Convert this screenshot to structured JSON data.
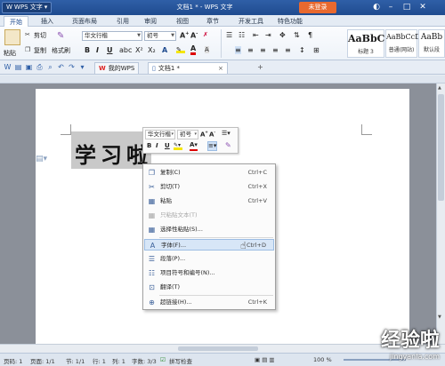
{
  "titlebar": {
    "app_name": "WPS 文字",
    "window_title": "文档1 * - WPS 文字",
    "login_label": "未登录"
  },
  "ribbon_tabs": [
    "开始",
    "插入",
    "页面布局",
    "引用",
    "审阅",
    "视图",
    "章节",
    "开发工具",
    "特色功能"
  ],
  "ribbon": {
    "paste_label": "粘贴",
    "cut_label": "剪切",
    "copy_label": "复制",
    "format_painter_label": "格式刷",
    "font_name": "华文行楷",
    "font_size": "初号",
    "styles": [
      {
        "sample": "AaBbC",
        "name": "标题 3"
      },
      {
        "sample": "AaBbCcD",
        "name": "普通(网站)"
      },
      {
        "sample": "AaBb",
        "name": "默认段"
      }
    ]
  },
  "doc_tabs": [
    {
      "label": "我的WPS",
      "active": false
    },
    {
      "label": "文档1 *",
      "active": true
    }
  ],
  "document": {
    "heading_text": "学习啦"
  },
  "mini_toolbar": {
    "font_name": "华文行楷",
    "font_size": "初号"
  },
  "context_menu": [
    {
      "label": "复制(C)",
      "shortcut": "Ctrl+C",
      "icon": "copy-icon",
      "disabled": false
    },
    {
      "label": "剪切(T)",
      "shortcut": "Ctrl+X",
      "icon": "cut-icon",
      "disabled": false
    },
    {
      "label": "粘贴",
      "shortcut": "Ctrl+V",
      "icon": "paste-icon",
      "disabled": false
    },
    {
      "label": "只粘贴文本(T)",
      "shortcut": "",
      "icon": "paste-text-icon",
      "disabled": true
    },
    {
      "label": "选择性粘贴(S)...",
      "shortcut": "",
      "icon": "paste-special-icon",
      "disabled": false
    },
    {
      "label": "字体(F)...",
      "shortcut": "Ctrl+D",
      "icon": "font-icon",
      "disabled": false
    },
    {
      "label": "段落(P)...",
      "shortcut": "",
      "icon": "paragraph-icon",
      "disabled": false
    },
    {
      "label": "项目符号和编号(N)...",
      "shortcut": "",
      "icon": "bullets-icon",
      "disabled": false
    },
    {
      "label": "翻译(T)",
      "shortcut": "",
      "icon": "translate-icon",
      "disabled": false
    },
    {
      "label": "超链接(H)...",
      "shortcut": "Ctrl+K",
      "icon": "hyperlink-icon",
      "disabled": false
    }
  ],
  "statusbar": {
    "page_num": "页码: 1",
    "pages": "页面: 1/1",
    "section": "节: 1/1",
    "row": "行: 1",
    "col": "列: 1",
    "word_count": "字数: 3/3",
    "spell_check": "拼写检查",
    "zoom": "100 %"
  },
  "watermark": {
    "logo_text": "经验啦",
    "url_text": "jingyanla.com"
  },
  "colors": {
    "title_bar": "#1f4b8f",
    "login_button": "#e8692f",
    "selection": "#c9c9c9",
    "menu_hover": "#d7e6f7"
  }
}
